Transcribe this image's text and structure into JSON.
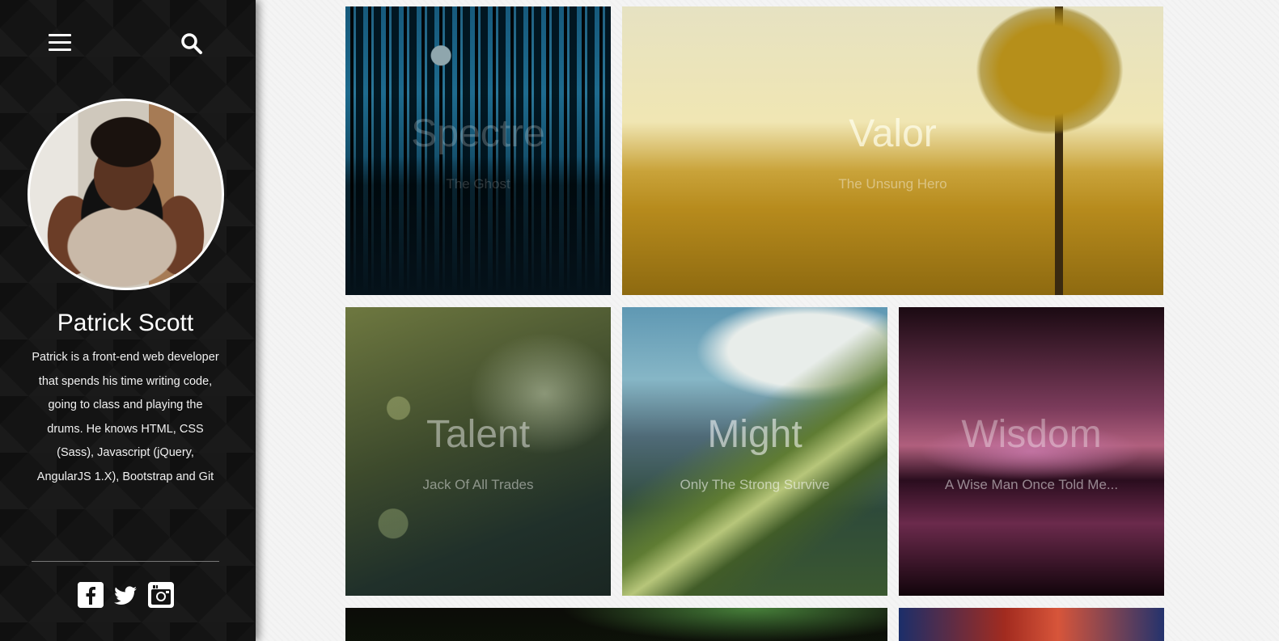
{
  "sidebar": {
    "name": "Patrick Scott",
    "bio": "Patrick is a front-end web developer that spends his time writing code, going to class and playing the drums. He knows HTML, CSS (Sass), Javascript (jQuery, AngularJS 1.X), Bootstrap and Git",
    "icons": {
      "menu": "hamburger-menu-icon",
      "search": "search-icon",
      "social": [
        "facebook-icon",
        "twitter-icon",
        "instagram-icon"
      ]
    }
  },
  "gallery": {
    "tiles": [
      {
        "title": "Spectre",
        "subtitle": "The Ghost"
      },
      {
        "title": "Valor",
        "subtitle": "The Unsung Hero"
      },
      {
        "title": "Talent",
        "subtitle": "Jack Of All Trades"
      },
      {
        "title": "Might",
        "subtitle": "Only The Strong Survive"
      },
      {
        "title": "Wisdom",
        "subtitle": "A Wise Man Once Told Me..."
      }
    ]
  },
  "colors": {
    "sidebar_bg": "#141414",
    "page_bg": "#f4f4f4",
    "text_light": "#ffffff"
  }
}
